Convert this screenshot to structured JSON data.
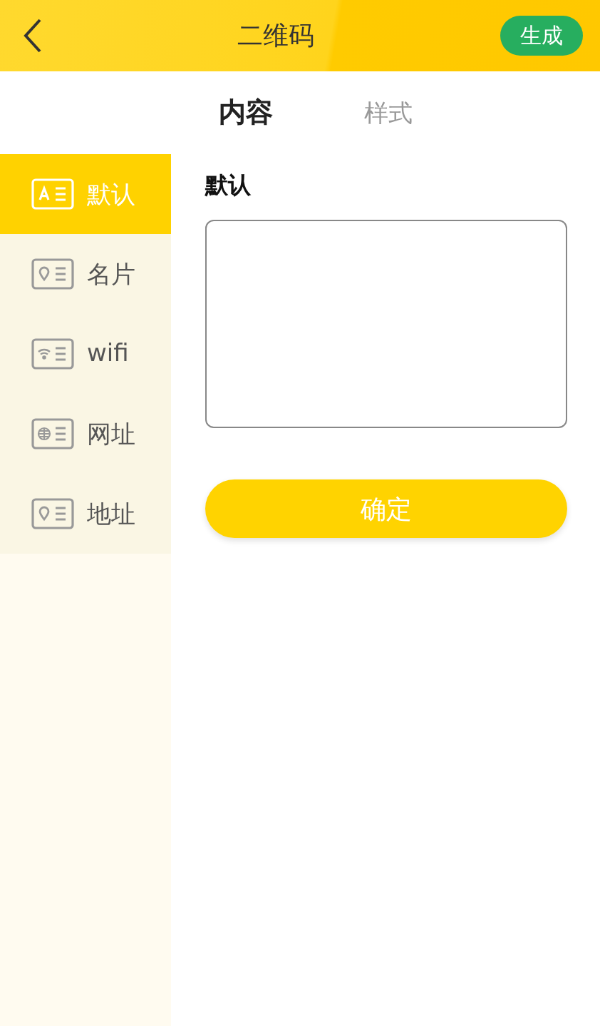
{
  "header": {
    "title": "二维码",
    "action": "生成"
  },
  "tabs": [
    {
      "label": "内容",
      "selected": true
    },
    {
      "label": "样式",
      "selected": false
    }
  ],
  "sidebar": {
    "items": [
      {
        "label": "默认",
        "kind": "text",
        "selected": true
      },
      {
        "label": "名片",
        "kind": "location",
        "selected": false
      },
      {
        "label": "wifi",
        "kind": "wifi",
        "selected": false
      },
      {
        "label": "网址",
        "kind": "globe",
        "selected": false
      },
      {
        "label": "地址",
        "kind": "location",
        "selected": false
      }
    ]
  },
  "form": {
    "label": "默认",
    "confirm": "确定"
  }
}
